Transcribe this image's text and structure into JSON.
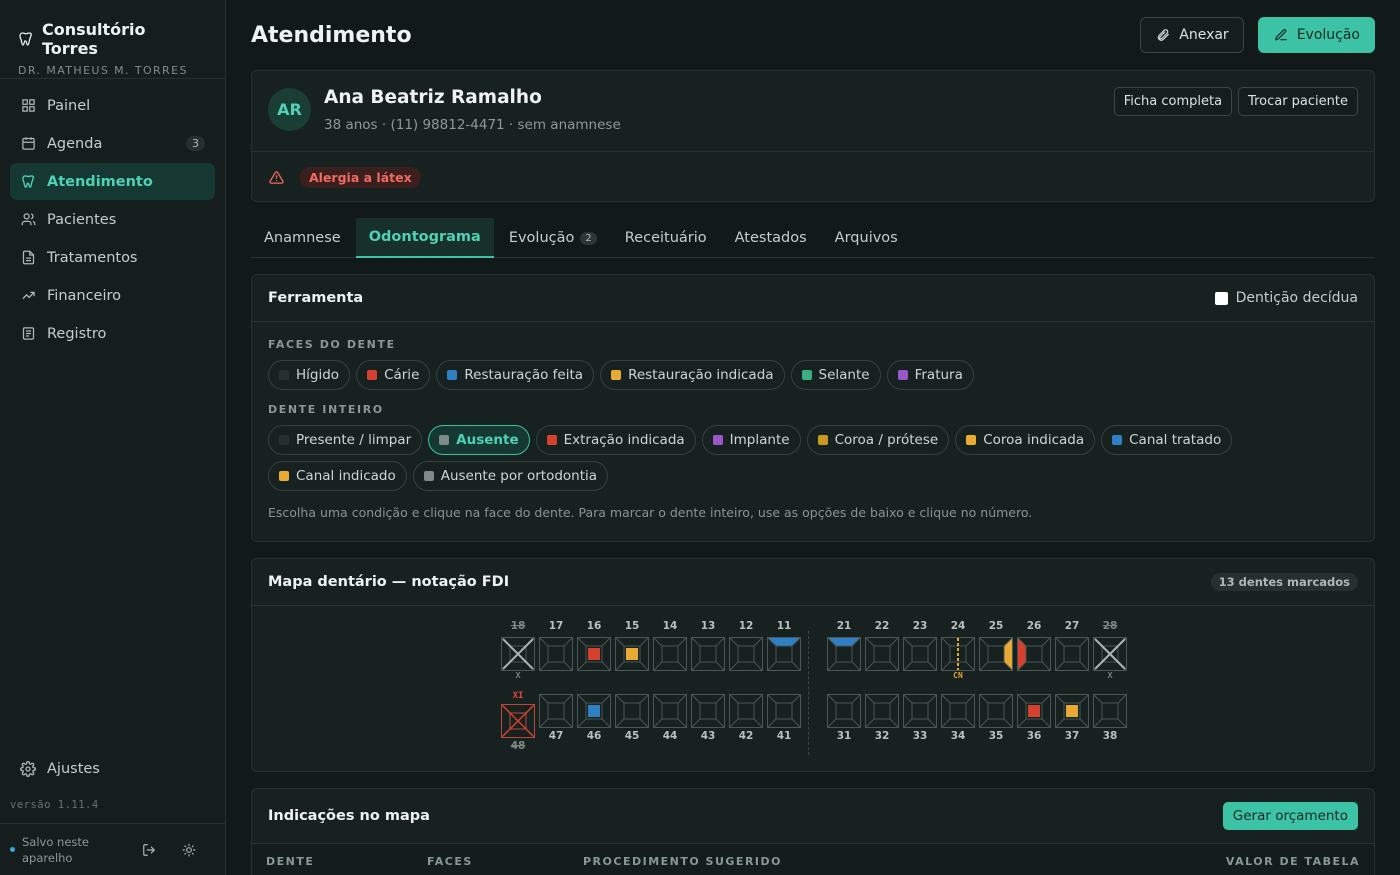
{
  "app": {
    "name": "Consultório Torres",
    "doctor": "DR. MATHEUS M. TORRES",
    "version": "versão 1.11.4",
    "save_status": "Salvo neste aparelho",
    "settings_label": "Ajustes"
  },
  "nav": [
    {
      "label": "Painel",
      "icon": "grid-icon"
    },
    {
      "label": "Agenda",
      "icon": "calendar-icon",
      "badge": "3"
    },
    {
      "label": "Atendimento",
      "icon": "tooth-icon",
      "active": true
    },
    {
      "label": "Pacientes",
      "icon": "users-icon"
    },
    {
      "label": "Tratamentos",
      "icon": "document-icon"
    },
    {
      "label": "Financeiro",
      "icon": "trend-icon"
    },
    {
      "label": "Registro",
      "icon": "list-icon"
    }
  ],
  "header": {
    "title": "Atendimento",
    "attach_label": "Anexar",
    "evolution_label": "Evolução"
  },
  "patient": {
    "initials": "AR",
    "name": "Ana Beatriz Ramalho",
    "meta": "38 anos · (11) 98812-4471 · sem anamnese",
    "full_record_label": "Ficha completa",
    "switch_label": "Trocar paciente",
    "alert": "Alergia a látex"
  },
  "tabs": [
    {
      "label": "Anamnese"
    },
    {
      "label": "Odontograma",
      "active": true
    },
    {
      "label": "Evolução",
      "count": "2"
    },
    {
      "label": "Receituário"
    },
    {
      "label": "Atestados"
    },
    {
      "label": "Arquivos"
    }
  ],
  "tool": {
    "title": "Ferramenta",
    "deciduous_label": "Dentição decídua",
    "faces_label": "FACES DO DENTE",
    "whole_label": "DENTE INTEIRO",
    "faces": [
      {
        "label": "Hígido",
        "color": "#26302e"
      },
      {
        "label": "Cárie",
        "color": "#d6412f"
      },
      {
        "label": "Restauração feita",
        "color": "#2f7fc4"
      },
      {
        "label": "Restauração indicada",
        "color": "#e8a935"
      },
      {
        "label": "Selante",
        "color": "#3cae84"
      },
      {
        "label": "Fratura",
        "color": "#9a55c8"
      }
    ],
    "whole": [
      {
        "label": "Presente / limpar",
        "color": "#26302e"
      },
      {
        "label": "Ausente",
        "color": "#7d8a87",
        "active": true
      },
      {
        "label": "Extração indicada",
        "color": "#d6412f"
      },
      {
        "label": "Implante",
        "color": "#9a55c8"
      },
      {
        "label": "Coroa / prótese",
        "color": "#c9961f"
      },
      {
        "label": "Coroa indicada",
        "color": "#e8a935"
      },
      {
        "label": "Canal tratado",
        "color": "#2f7fc4"
      },
      {
        "label": "Canal indicado",
        "color": "#e8a935"
      },
      {
        "label": "Ausente por ortodontia",
        "color": "#7d8a87"
      }
    ],
    "hint": "Escolha uma condição e clique na face do dente. Para marcar o dente inteiro, use as opções de baixo e clique no número."
  },
  "map": {
    "title": "Mapa dentário — notação FDI",
    "count_label": "13 dentes marcados",
    "upper_right": [
      {
        "n": "18",
        "state": "absent",
        "mark": "X"
      },
      {
        "n": "17"
      },
      {
        "n": "16",
        "center": "caries"
      },
      {
        "n": "15",
        "center": "restoration-indicated"
      },
      {
        "n": "14"
      },
      {
        "n": "13"
      },
      {
        "n": "12"
      },
      {
        "n": "11",
        "top": "restoration-done"
      }
    ],
    "upper_left": [
      {
        "n": "21",
        "top": "restoration-done"
      },
      {
        "n": "22"
      },
      {
        "n": "23"
      },
      {
        "n": "24",
        "canal": "canal-indicated",
        "mark": "CN"
      },
      {
        "n": "25",
        "right": "restoration-indicated"
      },
      {
        "n": "26",
        "left": "caries"
      },
      {
        "n": "27"
      },
      {
        "n": "28",
        "state": "absent",
        "mark": "X"
      }
    ],
    "lower_right": [
      {
        "n": "48",
        "state": "extraction",
        "mark": "XI"
      },
      {
        "n": "47"
      },
      {
        "n": "46",
        "center": "restoration-done"
      },
      {
        "n": "45"
      },
      {
        "n": "44"
      },
      {
        "n": "43"
      },
      {
        "n": "42"
      },
      {
        "n": "41"
      }
    ],
    "lower_left": [
      {
        "n": "31"
      },
      {
        "n": "32"
      },
      {
        "n": "33"
      },
      {
        "n": "34"
      },
      {
        "n": "35"
      },
      {
        "n": "36",
        "center": "caries"
      },
      {
        "n": "37",
        "center": "restoration-indicated"
      },
      {
        "n": "38"
      }
    ]
  },
  "indications": {
    "title": "Indicações no mapa",
    "budget_label": "Gerar orçamento",
    "columns": [
      "DENTE",
      "FACES",
      "PROCEDIMENTO SUGERIDO",
      "VALOR DE TABELA"
    ]
  },
  "colors": {
    "accent": "#3cc3a5",
    "caries": "#d6412f",
    "restoration-done": "#2f7fc4",
    "restoration-indicated": "#e8a935",
    "absent": "#8a9894",
    "extraction": "#d6412f"
  }
}
